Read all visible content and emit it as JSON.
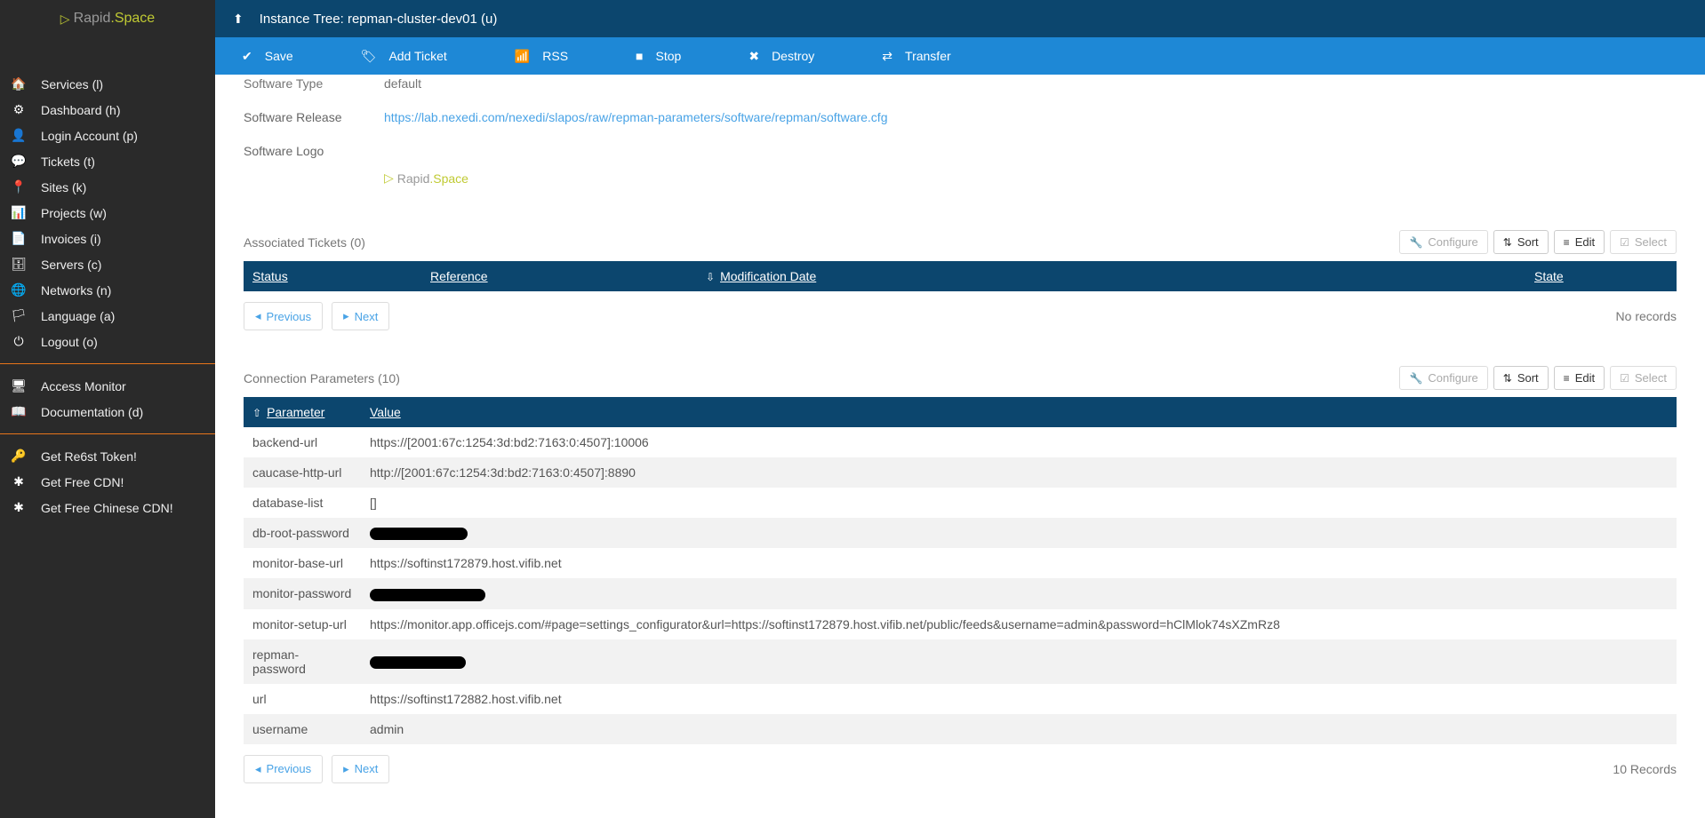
{
  "brand": {
    "rapid": "Rapid",
    "space": ".Space"
  },
  "sidebar": {
    "main": [
      {
        "icon": "🏠",
        "label": "Services (l)"
      },
      {
        "icon": "⚙",
        "label": "Dashboard (h)"
      },
      {
        "icon": "👤",
        "label": "Login Account (p)"
      },
      {
        "icon": "💬",
        "label": "Tickets (t)"
      },
      {
        "icon": "📍",
        "label": "Sites (k)"
      },
      {
        "icon": "📊",
        "label": "Projects (w)"
      },
      {
        "icon": "📄",
        "label": "Invoices (i)"
      },
      {
        "icon": "🗄",
        "label": "Servers (c)"
      },
      {
        "icon": "🌐",
        "label": "Networks (n)"
      },
      {
        "icon": "🏳",
        "label": "Language (a)"
      },
      {
        "icon": "⏻",
        "label": "Logout (o)"
      }
    ],
    "sec2": [
      {
        "icon": "🖥",
        "label": "Access Monitor"
      },
      {
        "icon": "📖",
        "label": "Documentation (d)"
      }
    ],
    "sec3": [
      {
        "icon": "🔑",
        "label": "Get Re6st Token!"
      },
      {
        "icon": "✱",
        "label": "Get Free CDN!"
      },
      {
        "icon": "✱",
        "label": "Get Free Chinese CDN!"
      }
    ]
  },
  "header": {
    "title": "Instance Tree: repman-cluster-dev01 (u)"
  },
  "toolbar": {
    "save": "Save",
    "add_ticket": "Add Ticket",
    "rss": "RSS",
    "stop": "Stop",
    "destroy": "Destroy",
    "transfer": "Transfer"
  },
  "info": {
    "software_type_label": "Software Type",
    "software_type_value": "default",
    "software_release_label": "Software Release",
    "software_release_value": "https://lab.nexedi.com/nexedi/slapos/raw/repman-parameters/software/repman/software.cfg",
    "software_logo_label": "Software Logo"
  },
  "tickets": {
    "title": "Associated Tickets (0)",
    "cols": {
      "status": "Status",
      "reference": "Reference",
      "mod": "Modification Date",
      "state": "State"
    },
    "no_records": "No records"
  },
  "actions": {
    "configure": "Configure",
    "sort": "Sort",
    "edit": "Edit",
    "select": "Select"
  },
  "pager": {
    "prev": "Previous",
    "next": "Next"
  },
  "params": {
    "title": "Connection Parameters (10)",
    "cols": {
      "param": "Parameter",
      "value": "Value"
    },
    "records": "10 Records",
    "rows": [
      {
        "p": "backend-url",
        "v": "https://[2001:67c:1254:3d:bd2:7163:0:4507]:10006",
        "redact": false
      },
      {
        "p": "caucase-http-url",
        "v": "http://[2001:67c:1254:3d:bd2:7163:0:4507]:8890",
        "redact": false
      },
      {
        "p": "database-list",
        "v": "[]",
        "redact": false
      },
      {
        "p": "db-root-password",
        "v": "",
        "redact": true,
        "rw": "w1"
      },
      {
        "p": "monitor-base-url",
        "v": "https://softinst172879.host.vifib.net",
        "redact": false
      },
      {
        "p": "monitor-password",
        "v": "",
        "redact": true,
        "rw": "w2"
      },
      {
        "p": "monitor-setup-url",
        "v": "https://monitor.app.officejs.com/#page=settings_configurator&url=https://softinst172879.host.vifib.net/public/feeds&username=admin&password=hClMlok74sXZmRz8",
        "redact": false
      },
      {
        "p": "repman-password",
        "v": "",
        "redact": true,
        "rw": "w3"
      },
      {
        "p": "url",
        "v": "https://softinst172882.host.vifib.net",
        "redact": false
      },
      {
        "p": "username",
        "v": "admin",
        "redact": false
      }
    ]
  }
}
